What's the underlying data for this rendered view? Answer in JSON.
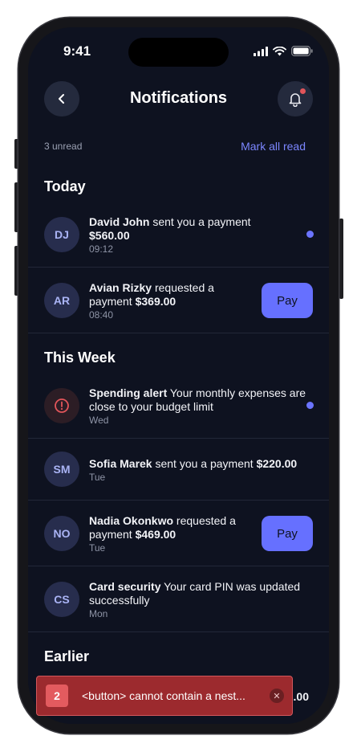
{
  "status": {
    "time": "9:41"
  },
  "header": {
    "title": "Notifications"
  },
  "summary": {
    "unread": "3 unread",
    "mark_all": "Mark all read"
  },
  "sections": {
    "today": "Today",
    "week": "This Week",
    "earlier": "Earlier"
  },
  "notifications": [
    {
      "initials": "DJ",
      "bold": "David John",
      "text": " sent you a payment ",
      "amount": "$560.00",
      "time": "09:12"
    },
    {
      "initials": "AR",
      "bold": "Avian Rizky",
      "text": " requested a payment ",
      "amount": "$369.00",
      "time": "08:40",
      "action": "Pay"
    },
    {
      "bold": "Spending alert",
      "text": " Your monthly expenses are close to your budget limit",
      "time": "Wed"
    },
    {
      "initials": "SM",
      "bold": "Sofia Marek",
      "text": " sent you a payment ",
      "amount": "$220.00",
      "time": "Tue"
    },
    {
      "initials": "NO",
      "bold": "Nadia Okonkwo",
      "text": " requested a payment ",
      "amount": "$469.00",
      "time": "Tue",
      "action": "Pay"
    },
    {
      "initials": "CS",
      "bold": "Card security",
      "text": " Your card PIN was updated successfully",
      "time": "Mon"
    },
    {
      "amount_partial": ".00"
    }
  ],
  "toast": {
    "count": "2",
    "message": "<button> cannot contain a nest..."
  },
  "colors": {
    "background": "#0e1220",
    "accent": "#6670ff",
    "unread_dot": "#6b74ff",
    "alert": "#e2555a",
    "error_toast": "#9c2a2e"
  }
}
